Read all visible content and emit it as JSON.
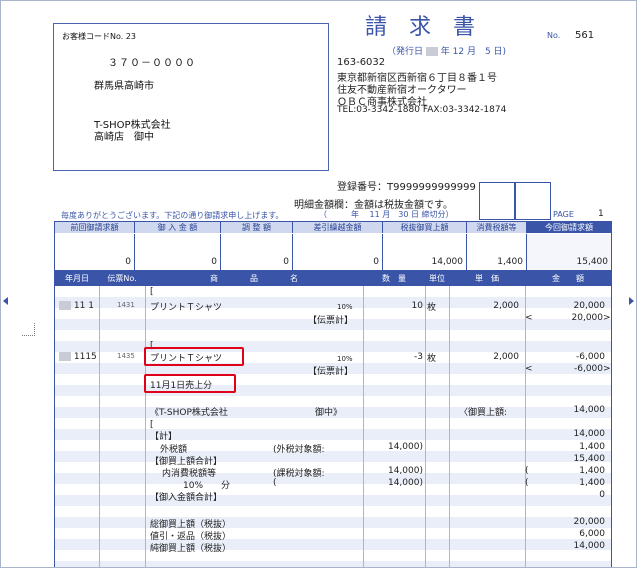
{
  "customer": {
    "code": "お客様コードNo. 23",
    "postal": "３７０－００００",
    "address": "群馬県高崎市",
    "company": "T-SHOP株式会社",
    "branch": "高崎店　御中"
  },
  "invoice": {
    "title": "請求書",
    "no_label": "No.",
    "no_value": "561",
    "issue_label": "（発行日",
    "issue_rest": "年 12 月　5 日)"
  },
  "issuer": {
    "postal": "163-6032",
    "address1": "東京都新宿区西新宿６丁目８番１号",
    "address2": "住友不動産新宿オークタワー",
    "company": "ＯＢＣ商事株式会社",
    "tel": "TEL:03-3342-1880 FAX:03-3342-1874",
    "reg_no": "登録番号：T9999999999999",
    "note": "明細金額欄：金額は税抜金額です。"
  },
  "greeting": "毎度ありがとうございます。下記の通り御請求申し上げます。",
  "closing": "（　　　年　 11 月　30 日 締切分）",
  "page": {
    "label": "PAGE",
    "num": "1"
  },
  "summary": {
    "headers": [
      "前回御請求額",
      "御 入 金 額",
      "調 整 額",
      "差引繰越金額",
      "税抜御買上額",
      "消費税額等",
      "今回御請求額"
    ],
    "values": [
      "0",
      "0",
      "0",
      "0",
      "14,000",
      "1,400",
      "15,400"
    ]
  },
  "detail": {
    "headers": [
      "年月日",
      "伝票No.",
      "商　　　　品　　　　名",
      "数　量",
      "単位",
      "単　価",
      "金　　額"
    ],
    "rows": {
      "r1_open": "[",
      "r1_date": "11 1",
      "r1_slip": "1431",
      "r1_name": "プリントＴシャツ",
      "r1_tax": "10%",
      "r1_qty": "10",
      "r1_unit": "枚",
      "r1_price": "2,000",
      "r1_amount": "20,000",
      "r1_slip_total": "【伝票計】",
      "r1_total_amount": "20,000",
      "r2_open": "[",
      "r2_date": "1115",
      "r2_slip": "1435",
      "r2_name": "プリントＴシャツ",
      "r2_tax": "10%",
      "r2_qty": "-3",
      "r2_unit": "枚",
      "r2_price": "2,000",
      "r2_amount": "-6,000",
      "r2_slip_total": "【伝票計】",
      "r2_total_amount": "-6,000",
      "r2_memo": "11月1日売上分",
      "cust_line": "《T-SHOP株式会社",
      "cust_onchu": "御中》",
      "purchase_label": "〈御買上額:",
      "purchase_amount": "14,000",
      "calc_open": "[",
      "calc_label": "【計】",
      "calc_amount": "14,000",
      "ext_tax": "外税額",
      "ext_tax_base": "(外税対象額:",
      "ext_tax_base_amt": "14,000)",
      "ext_tax_amt": "1,400",
      "buy_total_label": "【御買上額合計】",
      "buy_total_amt": "15,400",
      "int_tax": "内消費税額等",
      "int_tax_base": "(課税対象額:",
      "int_tax_base_amt": "14,000)",
      "int_tax_amt": "1,400",
      "rate_label": "10%　　分",
      "rate_base_amt": "14,000)",
      "rate_amt": "1,400",
      "paid_total_label": "【御入金額合計】",
      "paid_total_amt": "0",
      "gross_label": "総御買上額（税抜）",
      "gross_amt": "20,000",
      "return_label": "値引・返品（税抜）",
      "return_amt": "6,000",
      "net_label": "純御買上額（税抜）",
      "net_amt": "14,000",
      "lt": "<",
      "gt": ">",
      "paren": "(",
      "paren2": ")"
    }
  },
  "colors": {
    "accent": "#3a55a8",
    "highlight": "#e0001a",
    "stripe": "#e9eef9"
  }
}
